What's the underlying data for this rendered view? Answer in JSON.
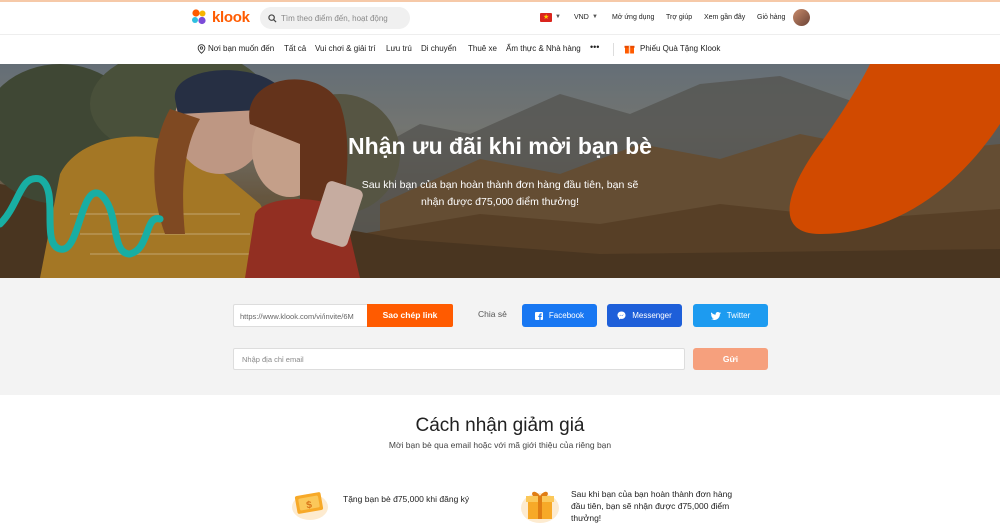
{
  "header": {
    "logo_text": "klook",
    "search_placeholder": "Tìm theo điểm đến, hoạt động",
    "currency": "VND",
    "links": [
      "Mở ứng dụng",
      "Trợ giúp",
      "Xem gần đây",
      "Giỏ hàng"
    ]
  },
  "nav": {
    "items": [
      "Nơi bạn muốn đến",
      "Tất cả",
      "Vui chơi & giải trí",
      "Lưu trú",
      "Di chuyển",
      "Thuê xe",
      "Ẩm thực & Nhà hàng"
    ],
    "more": "•••",
    "gift": "Phiếu Quà Tặng Klook"
  },
  "hero": {
    "title": "Nhận ưu đãi khi mời bạn bè",
    "subtitle": "Sau khi bạn của bạn hoàn thành đơn hàng đầu tiên, bạn sẽ nhận được đ75,000 điểm thưởng!"
  },
  "referral": {
    "link_value": "https://www.klook.com/vi/invite/6M",
    "copy_label": "Sao chép link",
    "share_label": "Chia sẻ",
    "facebook": "Facebook",
    "messenger": "Messenger",
    "twitter": "Twitter",
    "email_placeholder": "Nhập địa chỉ email",
    "send_label": "Gửi"
  },
  "how": {
    "title": "Cách nhận giảm giá",
    "subtitle": "Mời bạn bè qua email hoặc với mã giới thiệu của riêng bạn",
    "steps": [
      {
        "icon": "coupon-icon",
        "text": "Tặng bạn bè đ75,000 khi đăng ký"
      },
      {
        "icon": "gift-box-icon",
        "text": "Sau khi bạn của bạn hoàn thành đơn hàng đầu tiên, bạn sẽ nhận được đ75,000 điểm thưởng!"
      }
    ]
  },
  "colors": {
    "brand": "#ff5b00",
    "facebook": "#1877f2",
    "messenger": "#1e5fd9",
    "twitter": "#1d9bf0",
    "send_disabled": "#f6a07d"
  }
}
